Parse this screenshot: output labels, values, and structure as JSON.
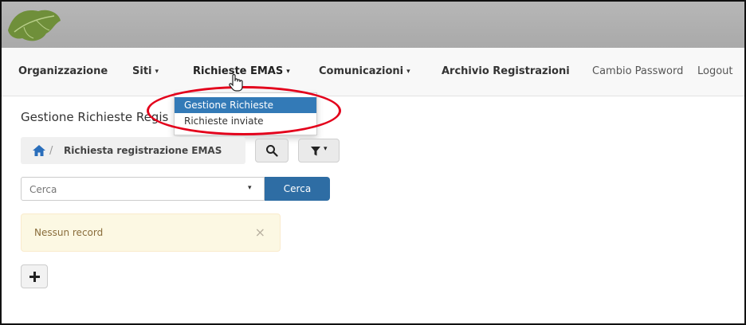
{
  "nav": {
    "items": [
      {
        "label": "Organizzazione",
        "caret": false
      },
      {
        "label": "Siti",
        "caret": true
      },
      {
        "label": "Richieste EMAS",
        "caret": true
      },
      {
        "label": "Comunicazioni",
        "caret": true
      },
      {
        "label": "Archivio Registrazioni",
        "caret": false
      },
      {
        "label": "Cambio Password",
        "caret": false
      },
      {
        "label": "Logout",
        "caret": false
      }
    ],
    "caret_glyph": "▾"
  },
  "dropdown": {
    "items": [
      {
        "label": "Gestione Richieste",
        "active": true
      },
      {
        "label": "Richieste inviate",
        "active": false
      }
    ]
  },
  "page": {
    "title": "Gestione Richieste Regis"
  },
  "breadcrumb": {
    "separator": "/",
    "label": "Richiesta registrazione EMAS"
  },
  "search": {
    "placeholder": "Cerca",
    "button_label": "Cerca"
  },
  "alert": {
    "text": "Nessun record",
    "close_glyph": "×"
  },
  "colors": {
    "primary": "#337ab7",
    "highlight": "#e3001b",
    "alert_bg": "#fcf8e3"
  }
}
